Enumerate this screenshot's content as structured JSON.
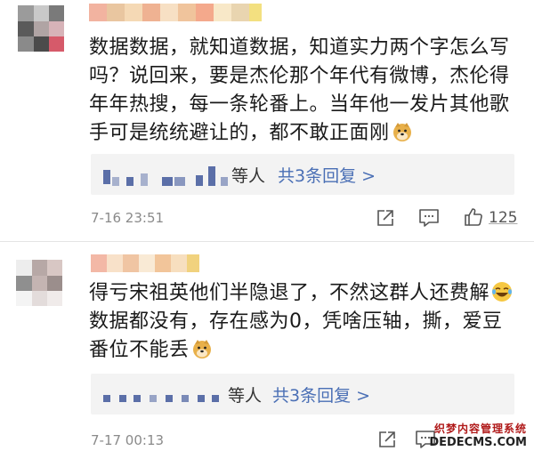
{
  "comments": [
    {
      "text": "数据数据，就知道数据，知道实力两个字怎么写吗？说回来，要是杰伦那个年代有微博，杰伦得年年热搜，每一条轮番上。当年他一发片其他歌手可是统统避让的，都不敢正面刚",
      "emoji": "doge-emoji",
      "reply_who": "等人",
      "reply_link": "共3条回复 >",
      "time": "7-16 23:51",
      "likes": "125"
    },
    {
      "text": "得亏宋祖英他们半隐退了，不然这群人还费解",
      "text2": "数据都没有，存在感为0，凭啥压轴，撕，爱豆番位不能丢",
      "emoji_mid": "laugh-cry-emoji",
      "emoji": "doge-emoji",
      "reply_who": "等人",
      "reply_link": "共3条回复 >",
      "time": "7-17 00:13"
    }
  ],
  "watermark": {
    "line1": "织梦内容管理系统",
    "line2": "DEDECMS.COM"
  },
  "colors": {
    "link": "#4a6fb5",
    "reply_bg": "#f3f3f3",
    "mosaic_blue": "#5b6fa8"
  }
}
